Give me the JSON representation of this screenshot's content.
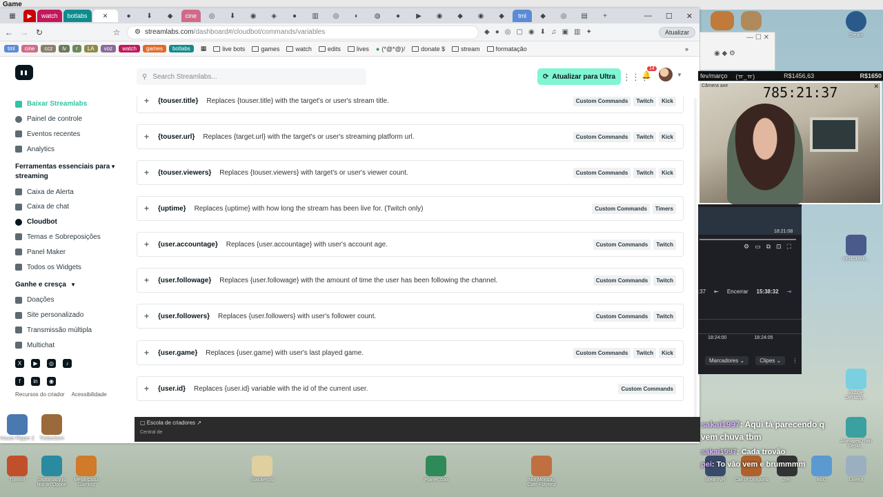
{
  "os": {
    "title": "Game"
  },
  "browser": {
    "tabs": [
      {
        "label": "",
        "color": "#444"
      },
      {
        "label": "",
        "color": "#cc0000"
      },
      {
        "label": "watch",
        "color": "#c2185b"
      },
      {
        "label": "botlabs",
        "color": "#0f8b8d"
      },
      {
        "label": "",
        "color": "#555"
      },
      {
        "label": "cine",
        "color": "#d06a8a"
      },
      {
        "label": "tml",
        "color": "#5b8bd6"
      }
    ],
    "url_host": "streamlabs.com",
    "url_path": "/dashboard#/cloudbot/commands/variables",
    "update_label": "Atualizar",
    "bookmark_chips": [
      {
        "label": "tml",
        "color": "#5b8bd6"
      },
      {
        "label": "cine",
        "color": "#d06a8a"
      },
      {
        "label": "ccz",
        "color": "#8a7f6a"
      },
      {
        "label": "lv",
        "color": "#6a7a5a"
      },
      {
        "label": "r",
        "color": "#6a8a5a"
      },
      {
        "label": "LA",
        "color": "#8f8a4a"
      },
      {
        "label": "voz",
        "color": "#8a6a9a"
      },
      {
        "label": "watch",
        "color": "#c2185b"
      },
      {
        "label": "games",
        "color": "#e06a2a"
      },
      {
        "label": "botlabs",
        "color": "#0f8b8d"
      }
    ],
    "bookmarks": [
      "live bots",
      "games",
      "watch",
      "edits",
      "lives",
      "(*@*@)/",
      "donate $",
      "stream",
      "formatação"
    ]
  },
  "page": {
    "search_placeholder": "Search Streamlabs...",
    "ultra_label": "Atualizar para Ultra",
    "notif_count": "14",
    "sidebar": {
      "top": [
        {
          "label": "Baixar Streamlabs",
          "kind": "dl"
        },
        {
          "label": "Painel de controle",
          "kind": ""
        },
        {
          "label": "Eventos recentes",
          "kind": ""
        },
        {
          "label": "Analytics",
          "kind": ""
        }
      ],
      "section1": "Ferramentas essenciais para streaming",
      "tools": [
        {
          "label": "Caixa de Alerta",
          "kind": ""
        },
        {
          "label": "Caixa de chat",
          "kind": ""
        },
        {
          "label": "Cloudbot",
          "kind": "active"
        },
        {
          "label": "Temas e Sobreposições",
          "kind": ""
        },
        {
          "label": "Panel Maker",
          "kind": ""
        },
        {
          "label": "Todos os Widgets",
          "kind": ""
        }
      ],
      "section2": "Ganhe e cresça",
      "grow": [
        {
          "label": "Doações",
          "kind": ""
        },
        {
          "label": "Site personalizado",
          "kind": ""
        },
        {
          "label": "Transmissão múltipla",
          "kind": ""
        },
        {
          "label": "Multichat",
          "kind": ""
        }
      ],
      "footer": [
        "Recursos do criador",
        "Acessibilidade"
      ]
    },
    "variables": [
      {
        "name": "{touser.title}",
        "desc": "Replaces {touser.title} with the target's or user's stream title.",
        "tags": [
          "Custom Commands",
          "Twitch",
          "Kick"
        ]
      },
      {
        "name": "{touser.url}",
        "desc": "Replaces {target.url} with the target's or user's streaming platform url.",
        "tags": [
          "Custom Commands",
          "Twitch",
          "Kick"
        ]
      },
      {
        "name": "{touser.viewers}",
        "desc": "Replaces {touser.viewers} with target's or user's viewer count.",
        "tags": [
          "Custom Commands",
          "Twitch",
          "Kick"
        ]
      },
      {
        "name": "{uptime}",
        "desc": "Replaces {uptime} with how long the stream has been live for. (Twitch only)",
        "tags": [
          "Custom Commands",
          "Timers"
        ]
      },
      {
        "name": "{user.accountage}",
        "desc": "Replaces {user.accountage} with user's account age.",
        "tags": [
          "Custom Commands",
          "Twitch"
        ]
      },
      {
        "name": "{user.followage}",
        "desc": "Replaces {user.followage} with the amount of time the user has been following the channel.",
        "tags": [
          "Custom Commands",
          "Twitch"
        ]
      },
      {
        "name": "{user.followers}",
        "desc": "Replaces {user.followers} with user's follower count.",
        "tags": [
          "Custom Commands",
          "Twitch"
        ]
      },
      {
        "name": "{user.game}",
        "desc": "Replaces {user.game} with user's last played game.",
        "tags": [
          "Custom Commands",
          "Twitch",
          "Kick"
        ]
      },
      {
        "name": "{user.id}",
        "desc": "Replaces {user.id} variable with the id of the current user.",
        "tags": [
          "Custom Commands"
        ]
      }
    ]
  },
  "strip": {
    "label": "Escola de criadores",
    "label2": "Central de"
  },
  "overlay": {
    "money_label": "fev/março",
    "money_sub": "(ㅠ_ㅠ)",
    "money1": "R$1456,63",
    "money2": "R$1650",
    "cam_title": "Câmera axe",
    "timer": "785:21:37",
    "obs_time_left": ":37",
    "obs_end": "Encerrar",
    "obs_clock": "15:38:32",
    "obs_small_clock": "18:21:08",
    "t1": "18:24:00",
    "t2": "18:24:05",
    "marcadores": "Marcadores",
    "clipes": "Clipes"
  },
  "desktop_icons": [
    {
      "label": "House Flipper 2",
      "color": "#4a78b0"
    },
    {
      "label": "Timberborn",
      "color": "#9a6a3a"
    },
    {
      "label": "Turmoil",
      "color": "#c0502a"
    },
    {
      "label": "Diplomacy is Not an Option",
      "color": "#2a8aa0"
    },
    {
      "label": "Mega Cubz Gaming",
      "color": "#d07a2a"
    },
    {
      "label": "Slackersts",
      "color": "#e0d0a0"
    },
    {
      "label": "Planet Zoo",
      "color": "#2f8a5a"
    },
    {
      "label": "Not Monday Cafe Playtest",
      "color": "#c07040"
    },
    {
      "label": "SteamVR",
      "color": "#3a4a6a"
    },
    {
      "label": "Call of Dragons",
      "color": "#b0602a"
    },
    {
      "label": "Zen",
      "color": "#333"
    },
    {
      "label": "BbG",
      "color": "#5a9ad0"
    },
    {
      "label": "Lixeira",
      "color": "#9ab0c0"
    },
    {
      "label": "Steam",
      "color": "#2a5a8a"
    },
    {
      "label": "XENOBRE...",
      "color": "#4a5a8a"
    },
    {
      "label": "Bubble Desktop...",
      "color": "#7ad0e0"
    },
    {
      "label": "Animated Rain Deskt...",
      "color": "#3aa0a0"
    }
  ],
  "chat": {
    "line1_user": "sakai1997",
    "line1_text": ": Aqui tá parecendo q vem chuva tbm",
    "line2_user": "sakai1997",
    "line2_text": ": Cada trovão",
    "line3_text": ": To vão vem e brummmm",
    "line3_user": "pei"
  }
}
